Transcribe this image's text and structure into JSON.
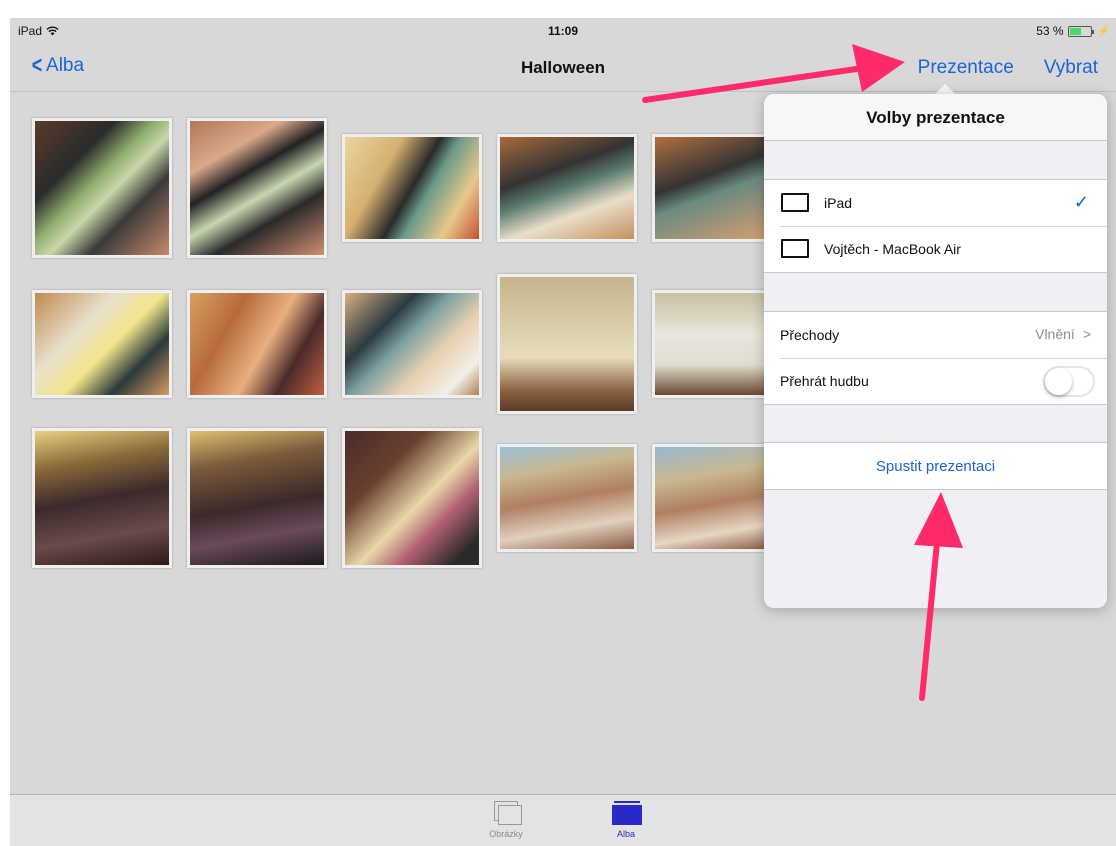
{
  "status_bar": {
    "device": "iPad",
    "time": "11:09",
    "battery": "53 %",
    "battery_level": 0.53
  },
  "nav": {
    "back_label": "Alba",
    "title": "Halloween",
    "present_label": "Prezentace",
    "select_label": "Vybrat"
  },
  "popover": {
    "title": "Volby prezentace",
    "devices": [
      {
        "label": "iPad",
        "selected": true
      },
      {
        "label": "Vojtěch - MacBook Air",
        "selected": false
      }
    ],
    "transitions_label": "Přechody",
    "transitions_value": "Vlnění",
    "music_label": "Přehrát hudbu",
    "music_on": false,
    "start_label": "Spustit prezentaci"
  },
  "tabbar": {
    "photos_label": "Obrázky",
    "albums_label": "Alba"
  },
  "colors": {
    "accent": "#1d62d6",
    "annotation_arrow": "#ff2a6a",
    "albums_tab": "#2a28c9"
  }
}
